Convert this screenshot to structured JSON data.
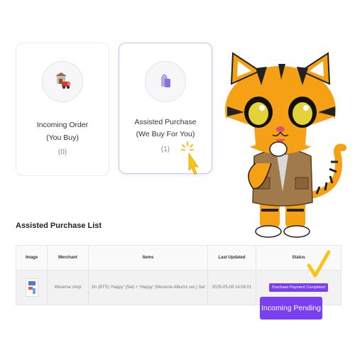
{
  "cards": {
    "incoming": {
      "title_line1": "Incoming Order",
      "title_line2": "(You Buy)",
      "count": "(0)",
      "icon": "store-truck-icon"
    },
    "assisted": {
      "title_line1": "Assisted Purchase",
      "title_line2": "(We Buy For You)",
      "count": "(1)",
      "icon": "shopping-bags-icon"
    }
  },
  "list": {
    "title": "Assisted Purchase List",
    "columns": [
      "Image",
      "Merchant",
      "Items",
      "Last Updated",
      "Status"
    ],
    "rows": [
      {
        "merchant": "Weverse shop",
        "items": "Jin (BTS) 'Happy' (Set) + 'Happy' (Weverse Albums ver.) Set",
        "last_updated": "2025-05-08 14:09:01",
        "status": "Purchase Payment Completed"
      }
    ]
  },
  "floating_button": {
    "label": "Incoming Pending"
  },
  "colors": {
    "accent_purple": "#7b3ff2",
    "check_yellow": "#f5c518",
    "tiger_orange": "#f5a015"
  }
}
